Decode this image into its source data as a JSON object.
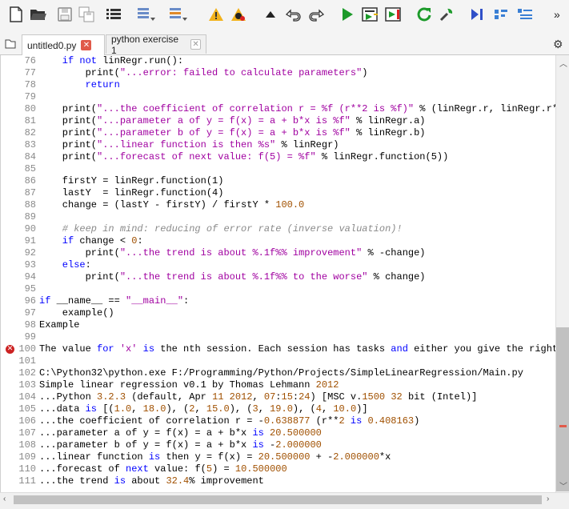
{
  "tabs": [
    {
      "label": "untitled0.py",
      "active": true
    },
    {
      "label": "python exercise 1",
      "active": false
    }
  ],
  "toolbar_icons": [
    "new-file-icon",
    "open-folder-icon",
    "save-icon",
    "save-all-icon",
    "list-icon",
    "indent-icon",
    "outdent-icon",
    "warning-icon",
    "bug-icon",
    "arrow-up-icon",
    "undo-icon",
    "redo-icon",
    "run-icon",
    "run-cell-icon",
    "run-cell-advance-icon",
    "rerun-icon",
    "debug-icon",
    "step-icon",
    "maximize-icon",
    "outline-icon",
    "more-icon"
  ],
  "code_lines": [
    {
      "n": "76",
      "segs": [
        [
          "kw",
          "    if not "
        ],
        [
          "",
          "linRegr.run():"
        ]
      ]
    },
    {
      "n": "77",
      "segs": [
        [
          "",
          "        print("
        ],
        [
          "str",
          "\"...error: failed to calculate parameters\""
        ],
        [
          "",
          ")"
        ]
      ]
    },
    {
      "n": "78",
      "segs": [
        [
          "kw",
          "        return"
        ]
      ]
    },
    {
      "n": "79",
      "segs": [
        [
          "",
          ""
        ]
      ]
    },
    {
      "n": "80",
      "segs": [
        [
          "",
          "    print("
        ],
        [
          "str",
          "\"...the coefficient of correlation r = %f (r**2 is %f)\""
        ],
        [
          "",
          " % (linRegr.r, linRegr.r*"
        ]
      ]
    },
    {
      "n": "81",
      "segs": [
        [
          "",
          "    print("
        ],
        [
          "str",
          "\"...parameter a of y = f(x) = a + b*x is %f\""
        ],
        [
          "",
          " % linRegr.a)"
        ]
      ]
    },
    {
      "n": "82",
      "segs": [
        [
          "",
          "    print("
        ],
        [
          "str",
          "\"...parameter b of y = f(x) = a + b*x is %f\""
        ],
        [
          "",
          " % linRegr.b)"
        ]
      ]
    },
    {
      "n": "83",
      "segs": [
        [
          "",
          "    print("
        ],
        [
          "str",
          "\"...linear function is then %s\""
        ],
        [
          "",
          " % linRegr)"
        ]
      ]
    },
    {
      "n": "84",
      "segs": [
        [
          "",
          "    print("
        ],
        [
          "str",
          "\"...forecast of next value: f(5) = %f\""
        ],
        [
          "",
          " % linRegr.function(5))"
        ]
      ]
    },
    {
      "n": "85",
      "segs": [
        [
          "",
          ""
        ]
      ]
    },
    {
      "n": "86",
      "segs": [
        [
          "",
          "    firstY = linRegr.function(1)"
        ]
      ]
    },
    {
      "n": "87",
      "segs": [
        [
          "",
          "    lastY  = linRegr.function(4)"
        ]
      ]
    },
    {
      "n": "88",
      "segs": [
        [
          "",
          "    change = (lastY - firstY) / firstY * "
        ],
        [
          "num",
          "100.0"
        ]
      ]
    },
    {
      "n": "89",
      "segs": [
        [
          "",
          ""
        ]
      ]
    },
    {
      "n": "90",
      "segs": [
        [
          "cmt",
          "    # keep in mind: reducing of error rate (inverse valuation)!"
        ]
      ]
    },
    {
      "n": "91",
      "segs": [
        [
          "kw",
          "    if "
        ],
        [
          "",
          "change < "
        ],
        [
          "num",
          "0"
        ],
        [
          "",
          ":"
        ]
      ]
    },
    {
      "n": "92",
      "segs": [
        [
          "",
          "        print("
        ],
        [
          "str",
          "\"...the trend is about %.1f%% improvement\""
        ],
        [
          "",
          " % -change)"
        ]
      ]
    },
    {
      "n": "93",
      "segs": [
        [
          "kw",
          "    else"
        ],
        [
          "",
          ":"
        ]
      ]
    },
    {
      "n": "94",
      "segs": [
        [
          "",
          "        print("
        ],
        [
          "str",
          "\"...the trend is about %.1f%% to the worse\""
        ],
        [
          "",
          " % change)"
        ]
      ]
    },
    {
      "n": "95",
      "segs": [
        [
          "",
          ""
        ]
      ]
    },
    {
      "n": "96",
      "segs": [
        [
          "kw",
          "if "
        ],
        [
          "",
          "__name__ == "
        ],
        [
          "str",
          "\"__main__\""
        ],
        [
          "",
          ":"
        ]
      ]
    },
    {
      "n": "97",
      "segs": [
        [
          "",
          "    example()"
        ]
      ]
    },
    {
      "n": "98",
      "segs": [
        [
          "",
          "Example"
        ]
      ]
    },
    {
      "n": "99",
      "segs": [
        [
          "",
          ""
        ]
      ]
    },
    {
      "n": "100",
      "err": true,
      "segs": [
        [
          "",
          "The value "
        ],
        [
          "kw",
          "for"
        ],
        [
          "",
          ""
        ],
        [
          "str",
          " 'x'"
        ],
        [
          "",
          ""
        ],
        [
          "kw",
          " is"
        ],
        [
          "",
          " the nth session. Each session has tasks "
        ],
        [
          "kw",
          "and"
        ],
        [
          "",
          " either you give the right"
        ]
      ]
    },
    {
      "n": "101",
      "segs": [
        [
          "",
          ""
        ]
      ]
    },
    {
      "n": "102",
      "segs": [
        [
          "",
          "C:\\Python32\\python.exe F:/Programming/Python/Projects/SimpleLinearRegression/Main.py"
        ]
      ]
    },
    {
      "n": "103",
      "segs": [
        [
          "",
          "Simple linear regression v0.1 by Thomas Lehmann "
        ],
        [
          "num",
          "2012"
        ]
      ]
    },
    {
      "n": "104",
      "segs": [
        [
          "",
          "...Python "
        ],
        [
          "num",
          "3.2.3"
        ],
        [
          "",
          " (default, Apr "
        ],
        [
          "num",
          "11"
        ],
        [
          "",
          ""
        ],
        [
          "num",
          " 2012"
        ],
        [
          "",
          ", "
        ],
        [
          "num",
          "07"
        ],
        [
          "",
          ":"
        ],
        [
          "num",
          "15"
        ],
        [
          "",
          ":"
        ],
        [
          "num",
          "24"
        ],
        [
          "",
          ") [MSC v."
        ],
        [
          "num",
          "1500"
        ],
        [
          "",
          ""
        ],
        [
          "num",
          " 32"
        ],
        [
          "",
          " bit (Intel)]"
        ]
      ]
    },
    {
      "n": "105",
      "segs": [
        [
          "",
          "...data "
        ],
        [
          "kw",
          "is"
        ],
        [
          "",
          " [("
        ],
        [
          "num",
          "1.0"
        ],
        [
          "",
          ", "
        ],
        [
          "num",
          "18.0"
        ],
        [
          "",
          "), ("
        ],
        [
          "num",
          "2"
        ],
        [
          "",
          ", "
        ],
        [
          "num",
          "15.0"
        ],
        [
          "",
          "), ("
        ],
        [
          "num",
          "3"
        ],
        [
          "",
          ", "
        ],
        [
          "num",
          "19.0"
        ],
        [
          "",
          "), ("
        ],
        [
          "num",
          "4"
        ],
        [
          "",
          ", "
        ],
        [
          "num",
          "10.0"
        ],
        [
          "",
          ")]"
        ]
      ]
    },
    {
      "n": "106",
      "segs": [
        [
          "",
          "...the coefficient of correlation r = -"
        ],
        [
          "num",
          "0.638877"
        ],
        [
          "",
          " (r**"
        ],
        [
          "num",
          "2"
        ],
        [
          "",
          ""
        ],
        [
          "kw",
          " is"
        ],
        [
          "",
          ""
        ],
        [
          "num",
          " 0.408163"
        ],
        [
          "",
          ")"
        ]
      ]
    },
    {
      "n": "107",
      "segs": [
        [
          "",
          "...parameter a of y = f(x) = a + b*x "
        ],
        [
          "kw",
          "is"
        ],
        [
          "",
          ""
        ],
        [
          "num",
          " 20.500000"
        ]
      ]
    },
    {
      "n": "108",
      "segs": [
        [
          "",
          "...parameter b of y = f(x) = a + b*x "
        ],
        [
          "kw",
          "is"
        ],
        [
          "",
          " -"
        ],
        [
          "num",
          "2.000000"
        ]
      ]
    },
    {
      "n": "109",
      "segs": [
        [
          "",
          "...linear function "
        ],
        [
          "kw",
          "is"
        ],
        [
          "",
          " then y = f(x) = "
        ],
        [
          "num",
          "20.500000"
        ],
        [
          "",
          " + -"
        ],
        [
          "num",
          "2.000000"
        ],
        [
          "",
          "*x"
        ]
      ]
    },
    {
      "n": "110",
      "segs": [
        [
          "",
          "...forecast of "
        ],
        [
          "kw",
          "next"
        ],
        [
          "",
          " value: f("
        ],
        [
          "num",
          "5"
        ],
        [
          "",
          ") = "
        ],
        [
          "num",
          "10.500000"
        ]
      ]
    },
    {
      "n": "111",
      "segs": [
        [
          "",
          "...the trend "
        ],
        [
          "kw",
          "is"
        ],
        [
          "",
          " about "
        ],
        [
          "num",
          "32.4"
        ],
        [
          "",
          "% improvement"
        ]
      ]
    }
  ]
}
